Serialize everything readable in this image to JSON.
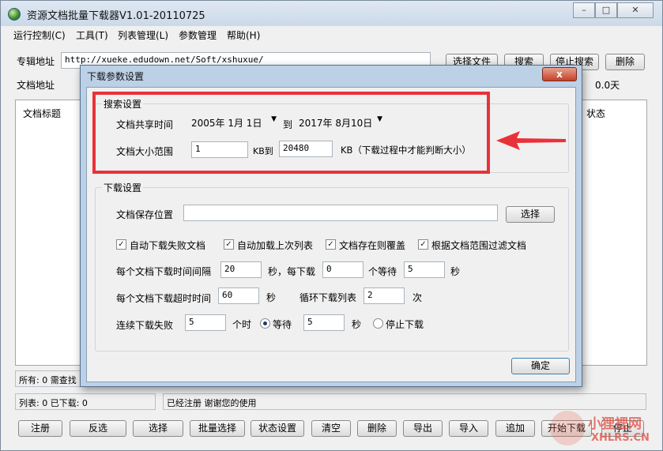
{
  "window": {
    "title": "资源文档批量下载器V1.01-20110725"
  },
  "menu": [
    "运行控制(C)",
    "工具(T)",
    "列表管理(L)",
    "参数管理",
    "帮助(H)"
  ],
  "toolbar": {
    "album_label": "专辑地址",
    "album_url": "http://xueke.edudown.net/Soft/xshuxue/",
    "doc_label": "文档地址",
    "select_file": "选择文件",
    "search": "搜索",
    "stop_search": "停止搜索",
    "delete": "删除",
    "days": "0.0天"
  },
  "list": {
    "col_title": "文档标题",
    "col_status": "状态"
  },
  "status": {
    "all": "所有: 0 需查找",
    "list": "列表: 0 已下载: 0",
    "registered": "已经注册 谢谢您的使用"
  },
  "bottom_buttons": [
    "注册",
    "反选",
    "选择",
    "批量选择",
    "状态设置",
    "清空",
    "删除",
    "导出",
    "导入",
    "追加",
    "开始下载",
    "停止"
  ],
  "dialog": {
    "title": "下载参数设置",
    "close": "x",
    "search_group": "搜索设置",
    "share_time_label": "文档共享时间",
    "date_from": "2005年 1月 1日",
    "to": "到",
    "date_to": "2017年 8月10日",
    "size_label": "文档大小范围",
    "size_min": "1",
    "kb_to": "KB到",
    "size_max": "20480",
    "size_note": "KB（下载过程中才能判断大小）",
    "download_group": "下载设置",
    "save_location_label": "文档保存位置",
    "save_location_value": "",
    "choose": "选择",
    "checks": [
      {
        "label": "自动下载失败文档",
        "checked": true
      },
      {
        "label": "自动加载上次列表",
        "checked": true
      },
      {
        "label": "文档存在则覆盖",
        "checked": true
      },
      {
        "label": "根据文档范围过滤文档",
        "checked": true
      }
    ],
    "interval_label": "每个文档下载时间间隔",
    "interval_value": "20",
    "sec_per": "秒，每下载",
    "per_count": "0",
    "wait_each": "个等待",
    "wait_value": "5",
    "sec": "秒",
    "timeout_label": "每个文档下载超时时间",
    "timeout_value": "60",
    "sec2": "秒",
    "loop_label": "循环下载列表",
    "loop_value": "2",
    "times": "次",
    "fail_label": "连续下载失败",
    "fail_value": "5",
    "fail_unit": "个时",
    "wait_label": "等待",
    "wait2_value": "5",
    "sec3": "秒",
    "stop_label": "停止下载",
    "ok": "确定"
  },
  "watermark": {
    "cn": "小狸裡网",
    "en": "XHLRS.CN"
  },
  "colors": {
    "annotation_red": "#e8323a",
    "dialog_frame": "#bcd0e6"
  }
}
